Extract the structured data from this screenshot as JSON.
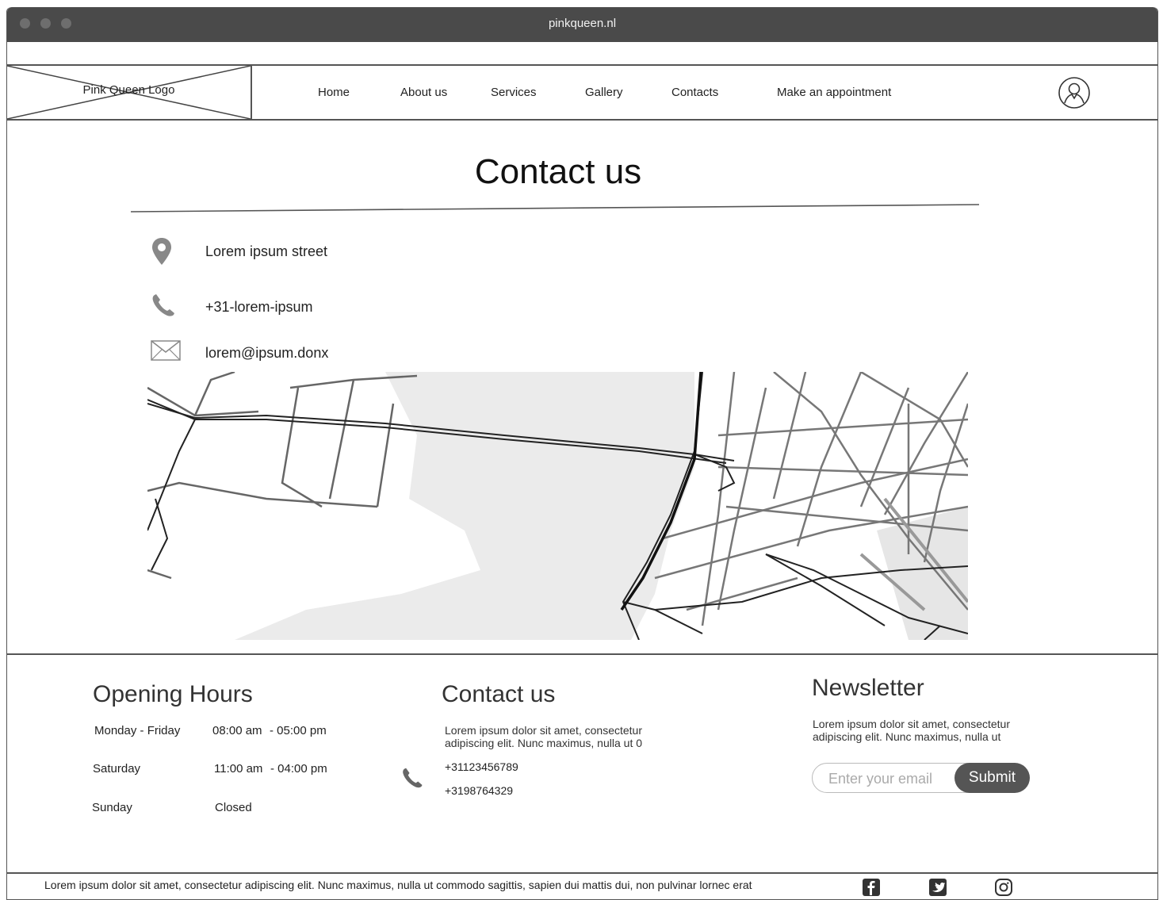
{
  "window": {
    "url": "pinkqueen.nl"
  },
  "header": {
    "logo_text": "Pink Queen Logo",
    "nav": [
      {
        "label": "Home"
      },
      {
        "label": "About us"
      },
      {
        "label": "Services"
      },
      {
        "label": "Gallery"
      },
      {
        "label": "Contacts"
      },
      {
        "label": "Make an appointment"
      }
    ],
    "user_icon": "user-icon"
  },
  "main": {
    "title": "Contact us",
    "contacts": [
      {
        "icon": "location-pin-icon",
        "text": "Lorem ipsum street"
      },
      {
        "icon": "phone-icon",
        "text": "+31-lorem-ipsum"
      },
      {
        "icon": "envelope-icon",
        "text": "lorem@ipsum.donx"
      }
    ],
    "map_icon": "map-image"
  },
  "footer": {
    "opening_hours": {
      "title": "Opening Hours",
      "rows": [
        {
          "day": "Monday - Friday",
          "open": "08:00 am",
          "close": "- 05:00 pm"
        },
        {
          "day": "Saturday",
          "open": "11:00 am",
          "close": "- 04:00 pm"
        },
        {
          "day": "Sunday",
          "open": "Closed",
          "close": ""
        }
      ]
    },
    "contact": {
      "title": "Contact us",
      "description_line1": "Lorem ipsum dolor sit amet, consectetur",
      "description_line2": "adipiscing elit. Nunc maximus, nulla ut 0",
      "phone1": "+31123456789",
      "phone2": "+3198764329"
    },
    "newsletter": {
      "title": "Newsletter",
      "description_line1": "Lorem ipsum dolor sit amet, consectetur",
      "description_line2": "adipiscing elit. Nunc maximus, nulla ut",
      "placeholder": "Enter your email",
      "submit_label": "Submit"
    },
    "bottom_text": "Lorem ipsum dolor sit amet, consectetur adipiscing elit. Nunc maximus, nulla ut commodo sagittis, sapien dui mattis dui, non pulvinar lornec erat",
    "social": [
      "facebook-icon",
      "twitter-icon",
      "instagram-icon"
    ]
  }
}
